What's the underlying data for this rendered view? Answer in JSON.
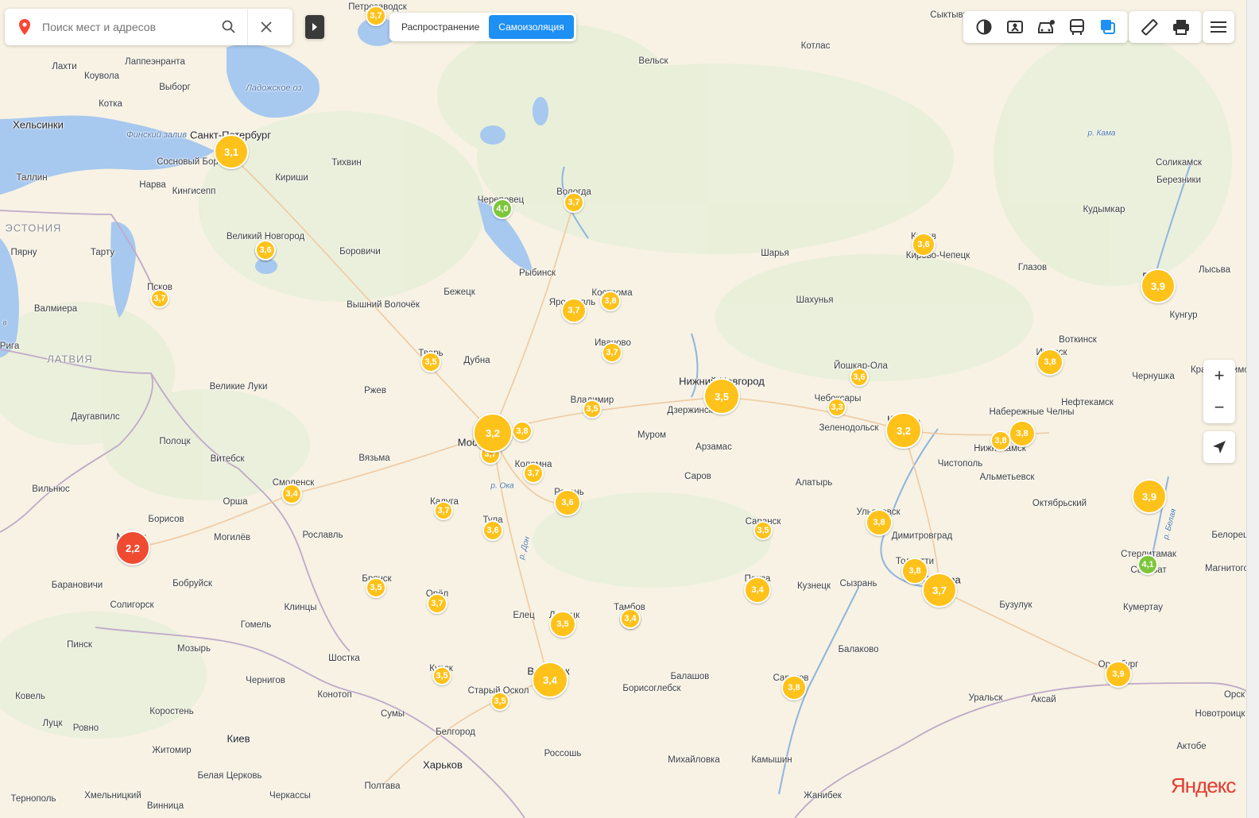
{
  "search": {
    "placeholder": "Поиск мест и адресов"
  },
  "layer_tabs": [
    {
      "label": "Распространение",
      "active": false
    },
    {
      "label": "Самоизоляция",
      "active": true
    }
  ],
  "tools": [
    "traffic-layer-icon",
    "panorama-icon",
    "car-icon",
    "transit-icon",
    "layers-icon"
  ],
  "tools2": [
    "ruler-icon",
    "print-icon"
  ],
  "zoom": {
    "in": "+",
    "out": "−"
  },
  "logo": "Яндекс",
  "colors": {
    "bubble_yellow": "#ffc21a",
    "bubble_green": "#7dc63b",
    "bubble_red": "#ef4b30",
    "accent": "#1e8ff3"
  },
  "country_labels": [
    "ЭСТОНИЯ",
    "ЛАТВИЯ"
  ],
  "water_labels": [
    "Ладожское оз.",
    "Финский залив",
    "р. Ока",
    "р. Дон",
    "р. Кама",
    "р. Белая",
    "в"
  ],
  "places": [
    "Петрозаводск",
    "Сыктывкар",
    "Котлас",
    "Вельск",
    "Лахти",
    "Коувола",
    "Лаппеэнранта",
    "Выборг",
    "Котка",
    "Хельсинки",
    "Санкт-Петербург",
    "Сосновый Бор",
    "Тихвин",
    "Кириши",
    "Таллин",
    "Нарва",
    "Кингисепп",
    "Череповец",
    "Вологда",
    "Великий Новгород",
    "Боровичи",
    "Рыбинск",
    "Пярну",
    "Тарту",
    "Псков",
    "Валмиера",
    "Рига",
    "Бежецк",
    "Вышний Волочёк",
    "Ярославль",
    "Кострома",
    "Иваново",
    "Тверь",
    "Дубна",
    "Великие Луки",
    "Ржев",
    "Даугавпилс",
    "Полоцк",
    "Витебск",
    "Вязьма",
    "Смоленск",
    "Орша",
    "Вильнюс",
    "Минск",
    "Борисов",
    "Могилёв",
    "Барановичи",
    "Бобруйск",
    "Солигорск",
    "Пинск",
    "Мозырь",
    "Гомель",
    "Рославль",
    "Клинцы",
    "Брянск",
    "Калуга",
    "Тула",
    "Орёл",
    "Москва",
    "Коломна",
    "Рязань",
    "Владимир",
    "Муром",
    "Нижний Новгород",
    "Дзержинск",
    "Арзамас",
    "Саров",
    "Чебоксары",
    "Йошкар-Ола",
    "Шарья",
    "Шахунья",
    "Киров",
    "Кирово-Чепецк",
    "Глазов",
    "Ижевск",
    "Воткинск",
    "Пермь",
    "Соликамск",
    "Березники",
    "Кудымкар",
    "Кунгур",
    "Лысьва",
    "Чернушка",
    "Набережные Челны",
    "Нижнекамск",
    "Нефтекамск",
    "Казань",
    "Зеленодольск",
    "Чистополь",
    "Альметьевск",
    "Октябрьский",
    "Уфа",
    "Стерлитамак",
    "Салават",
    "Белорецк",
    "Магнитогорск",
    "Кумертау",
    "Бузулук",
    "Оренбург",
    "Уральск",
    "Аксай",
    "Актобе",
    "Орск",
    "Новотроицк",
    "Самара",
    "Тольятти",
    "Сызрань",
    "Ульяновск",
    "Димитровград",
    "Алатырь",
    "Саранск",
    "Пенза",
    "Кузнецк",
    "Тамбов",
    "Липецк",
    "Елец",
    "Воронеж",
    "Курск",
    "Старый Оскол",
    "Белгород",
    "Харьков",
    "Шостка",
    "Чернигов",
    "Конотоп",
    "Сумы",
    "Киев",
    "Житомир",
    "Ровно",
    "Луцк",
    "Ковель",
    "Коростень",
    "Белая Церковь",
    "Черкассы",
    "Полтава",
    "Хмельницкий",
    "Тернополь",
    "Винница",
    "Россошь",
    "Борисоглебск",
    "Балашов",
    "Михайловка",
    "Камышин",
    "Саратов",
    "Балаково",
    "Жанибек",
    "Красноуфимск"
  ],
  "bubbles": [
    {
      "v": "3,7",
      "c": "yellow"
    },
    {
      "v": "3,1",
      "c": "yellow"
    },
    {
      "v": "3,6",
      "c": "yellow"
    },
    {
      "v": "4,0",
      "c": "green"
    },
    {
      "v": "3,7",
      "c": "yellow"
    },
    {
      "v": "3,6",
      "c": "yellow"
    },
    {
      "v": "3,7",
      "c": "yellow"
    },
    {
      "v": "3,7",
      "c": "yellow"
    },
    {
      "v": "3,8",
      "c": "yellow"
    },
    {
      "v": "3,7",
      "c": "yellow"
    },
    {
      "v": "3,5",
      "c": "yellow"
    },
    {
      "v": "3,2",
      "c": "yellow"
    },
    {
      "v": "3,8",
      "c": "yellow"
    },
    {
      "v": "3,7",
      "c": "yellow"
    },
    {
      "v": "3,5",
      "c": "yellow"
    },
    {
      "v": "3,7",
      "c": "yellow"
    },
    {
      "v": "3,6",
      "c": "yellow"
    },
    {
      "v": "3,7",
      "c": "yellow"
    },
    {
      "v": "3,6",
      "c": "yellow"
    },
    {
      "v": "3,4",
      "c": "yellow"
    },
    {
      "v": "2,2",
      "c": "red"
    },
    {
      "v": "3,5",
      "c": "yellow"
    },
    {
      "v": "3,7",
      "c": "yellow"
    },
    {
      "v": "3,5",
      "c": "yellow"
    },
    {
      "v": "3,4",
      "c": "yellow"
    },
    {
      "v": "3,5",
      "c": "yellow"
    },
    {
      "v": "3,4",
      "c": "yellow"
    },
    {
      "v": "3,5",
      "c": "yellow"
    },
    {
      "v": "3,2",
      "c": "yellow"
    },
    {
      "v": "3,5",
      "c": "yellow"
    },
    {
      "v": "3,6",
      "c": "yellow"
    },
    {
      "v": "3,3",
      "c": "yellow"
    },
    {
      "v": "3,2",
      "c": "yellow"
    },
    {
      "v": "3,6",
      "c": "yellow"
    },
    {
      "v": "3,8",
      "c": "yellow"
    },
    {
      "v": "3,8",
      "c": "yellow"
    },
    {
      "v": "3,8",
      "c": "yellow"
    },
    {
      "v": "3,9",
      "c": "yellow"
    },
    {
      "v": "3,9",
      "c": "yellow"
    },
    {
      "v": "4,1",
      "c": "green"
    },
    {
      "v": "3,8",
      "c": "yellow"
    },
    {
      "v": "3,8",
      "c": "yellow"
    },
    {
      "v": "3,7",
      "c": "yellow"
    },
    {
      "v": "3,4",
      "c": "yellow"
    },
    {
      "v": "3,5",
      "c": "yellow"
    },
    {
      "v": "3,8",
      "c": "yellow"
    },
    {
      "v": "3,9",
      "c": "yellow"
    },
    {
      "v": "3,5",
      "c": "yellow"
    }
  ]
}
